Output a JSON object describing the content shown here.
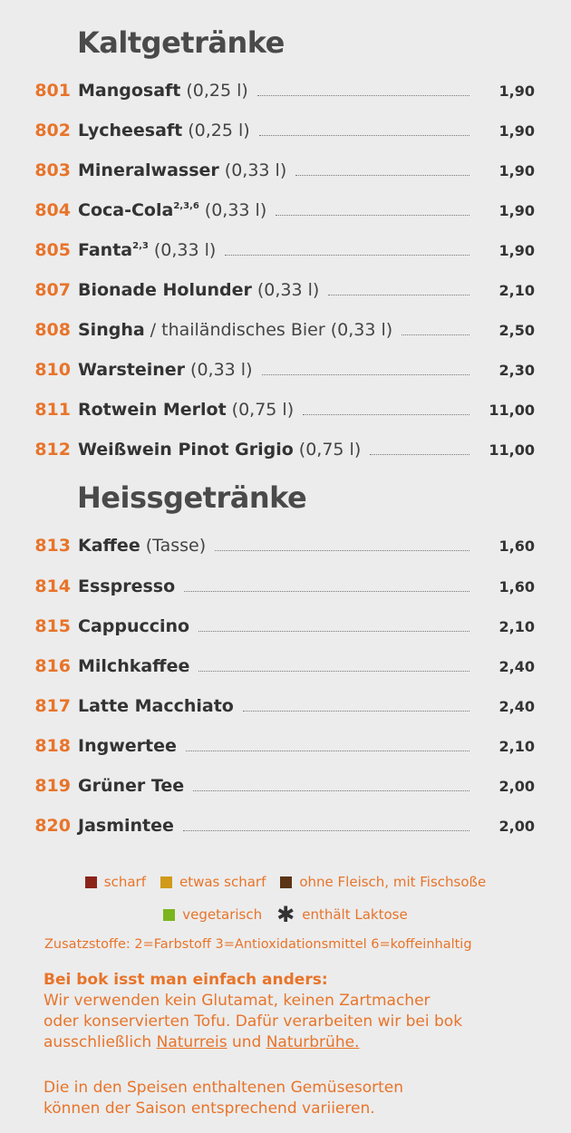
{
  "cold_section": {
    "title": "Kaltgetränke",
    "items": [
      {
        "num": "801",
        "name": "Mangosaft",
        "sup": "",
        "detail": "(0,25 l)",
        "price": "1,90"
      },
      {
        "num": "802",
        "name": "Lycheesaft",
        "sup": "",
        "detail": "(0,25 l)",
        "price": "1,90"
      },
      {
        "num": "803",
        "name": "Mineralwasser",
        "sup": "",
        "detail": "(0,33 l)",
        "price": "1,90"
      },
      {
        "num": "804",
        "name": "Coca-Cola",
        "sup": "2,3,6",
        "detail": "(0,33 l)",
        "price": "1,90"
      },
      {
        "num": "805",
        "name": "Fanta",
        "sup": "2,3",
        "detail": "(0,33 l)",
        "price": "1,90"
      },
      {
        "num": "807",
        "name": "Bionade Holunder",
        "sup": "",
        "detail": "(0,33 l)",
        "price": "2,10"
      },
      {
        "num": "808",
        "name": "Singha",
        "sup": "",
        "detail": "/ thailändisches Bier (0,33 l)",
        "price": "2,50"
      },
      {
        "num": "810",
        "name": "Warsteiner",
        "sup": "",
        "detail": "(0,33 l)",
        "price": "2,30"
      },
      {
        "num": "811",
        "name": "Rotwein Merlot",
        "sup": "",
        "detail": "(0,75 l)",
        "price": "11,00"
      },
      {
        "num": "812",
        "name": "Weißwein Pinot Grigio",
        "sup": "",
        "detail": "(0,75 l)",
        "price": "11,00"
      }
    ]
  },
  "hot_section": {
    "title": "Heissgetränke",
    "items": [
      {
        "num": "813",
        "name": "Kaffee",
        "detail": "(Tasse)",
        "price": "1,60"
      },
      {
        "num": "814",
        "name": "Esspresso",
        "detail": "",
        "price": "1,60"
      },
      {
        "num": "815",
        "name": "Cappuccino",
        "detail": "",
        "price": "2,10"
      },
      {
        "num": "816",
        "name": "Milchkaffee",
        "detail": "",
        "price": "2,40"
      },
      {
        "num": "817",
        "name": "Latte Macchiato",
        "detail": "",
        "price": "2,40"
      },
      {
        "num": "818",
        "name": "Ingwertee",
        "detail": "",
        "price": "2,10"
      },
      {
        "num": "819",
        "name": "Grüner Tee",
        "detail": "",
        "price": "2,00"
      },
      {
        "num": "820",
        "name": "Jasmintee",
        "detail": "",
        "price": "2,00"
      }
    ]
  },
  "legend": {
    "scharf": {
      "label": "scharf",
      "color": "#8b2418"
    },
    "etwas_scharf": {
      "label": "etwas scharf",
      "color": "#d19a1a"
    },
    "ohne_fleisch": {
      "label": "ohne Fleisch, mit Fischsoße",
      "color": "#5a3516"
    },
    "vegetarisch": {
      "label": "vegetarisch",
      "color": "#7ab51d"
    },
    "laktose": {
      "label": "enthält Laktose",
      "icon": "asterisk-icon"
    }
  },
  "additives": "Zusatzstoffe: 2=Farbstoff 3=Antioxidationsmittel 6=koffeinhaltig",
  "note": {
    "heading": "Bei bok isst man einfach anders:",
    "line1": "Wir verwenden kein Glutamat, keinen Zartmacher",
    "line2": "oder konservierten Tofu. Dafür verarbeiten wir bei bok",
    "line3_start": "ausschließlich",
    "link1": "Naturreis",
    "line3_mid": "und",
    "link2": "Naturbrühe."
  },
  "season_note": {
    "line1": "Die in den Speisen enthaltenen Gemüsesorten",
    "line2": "können der Saison entsprechend variieren."
  },
  "accent_color": "#e8742a"
}
